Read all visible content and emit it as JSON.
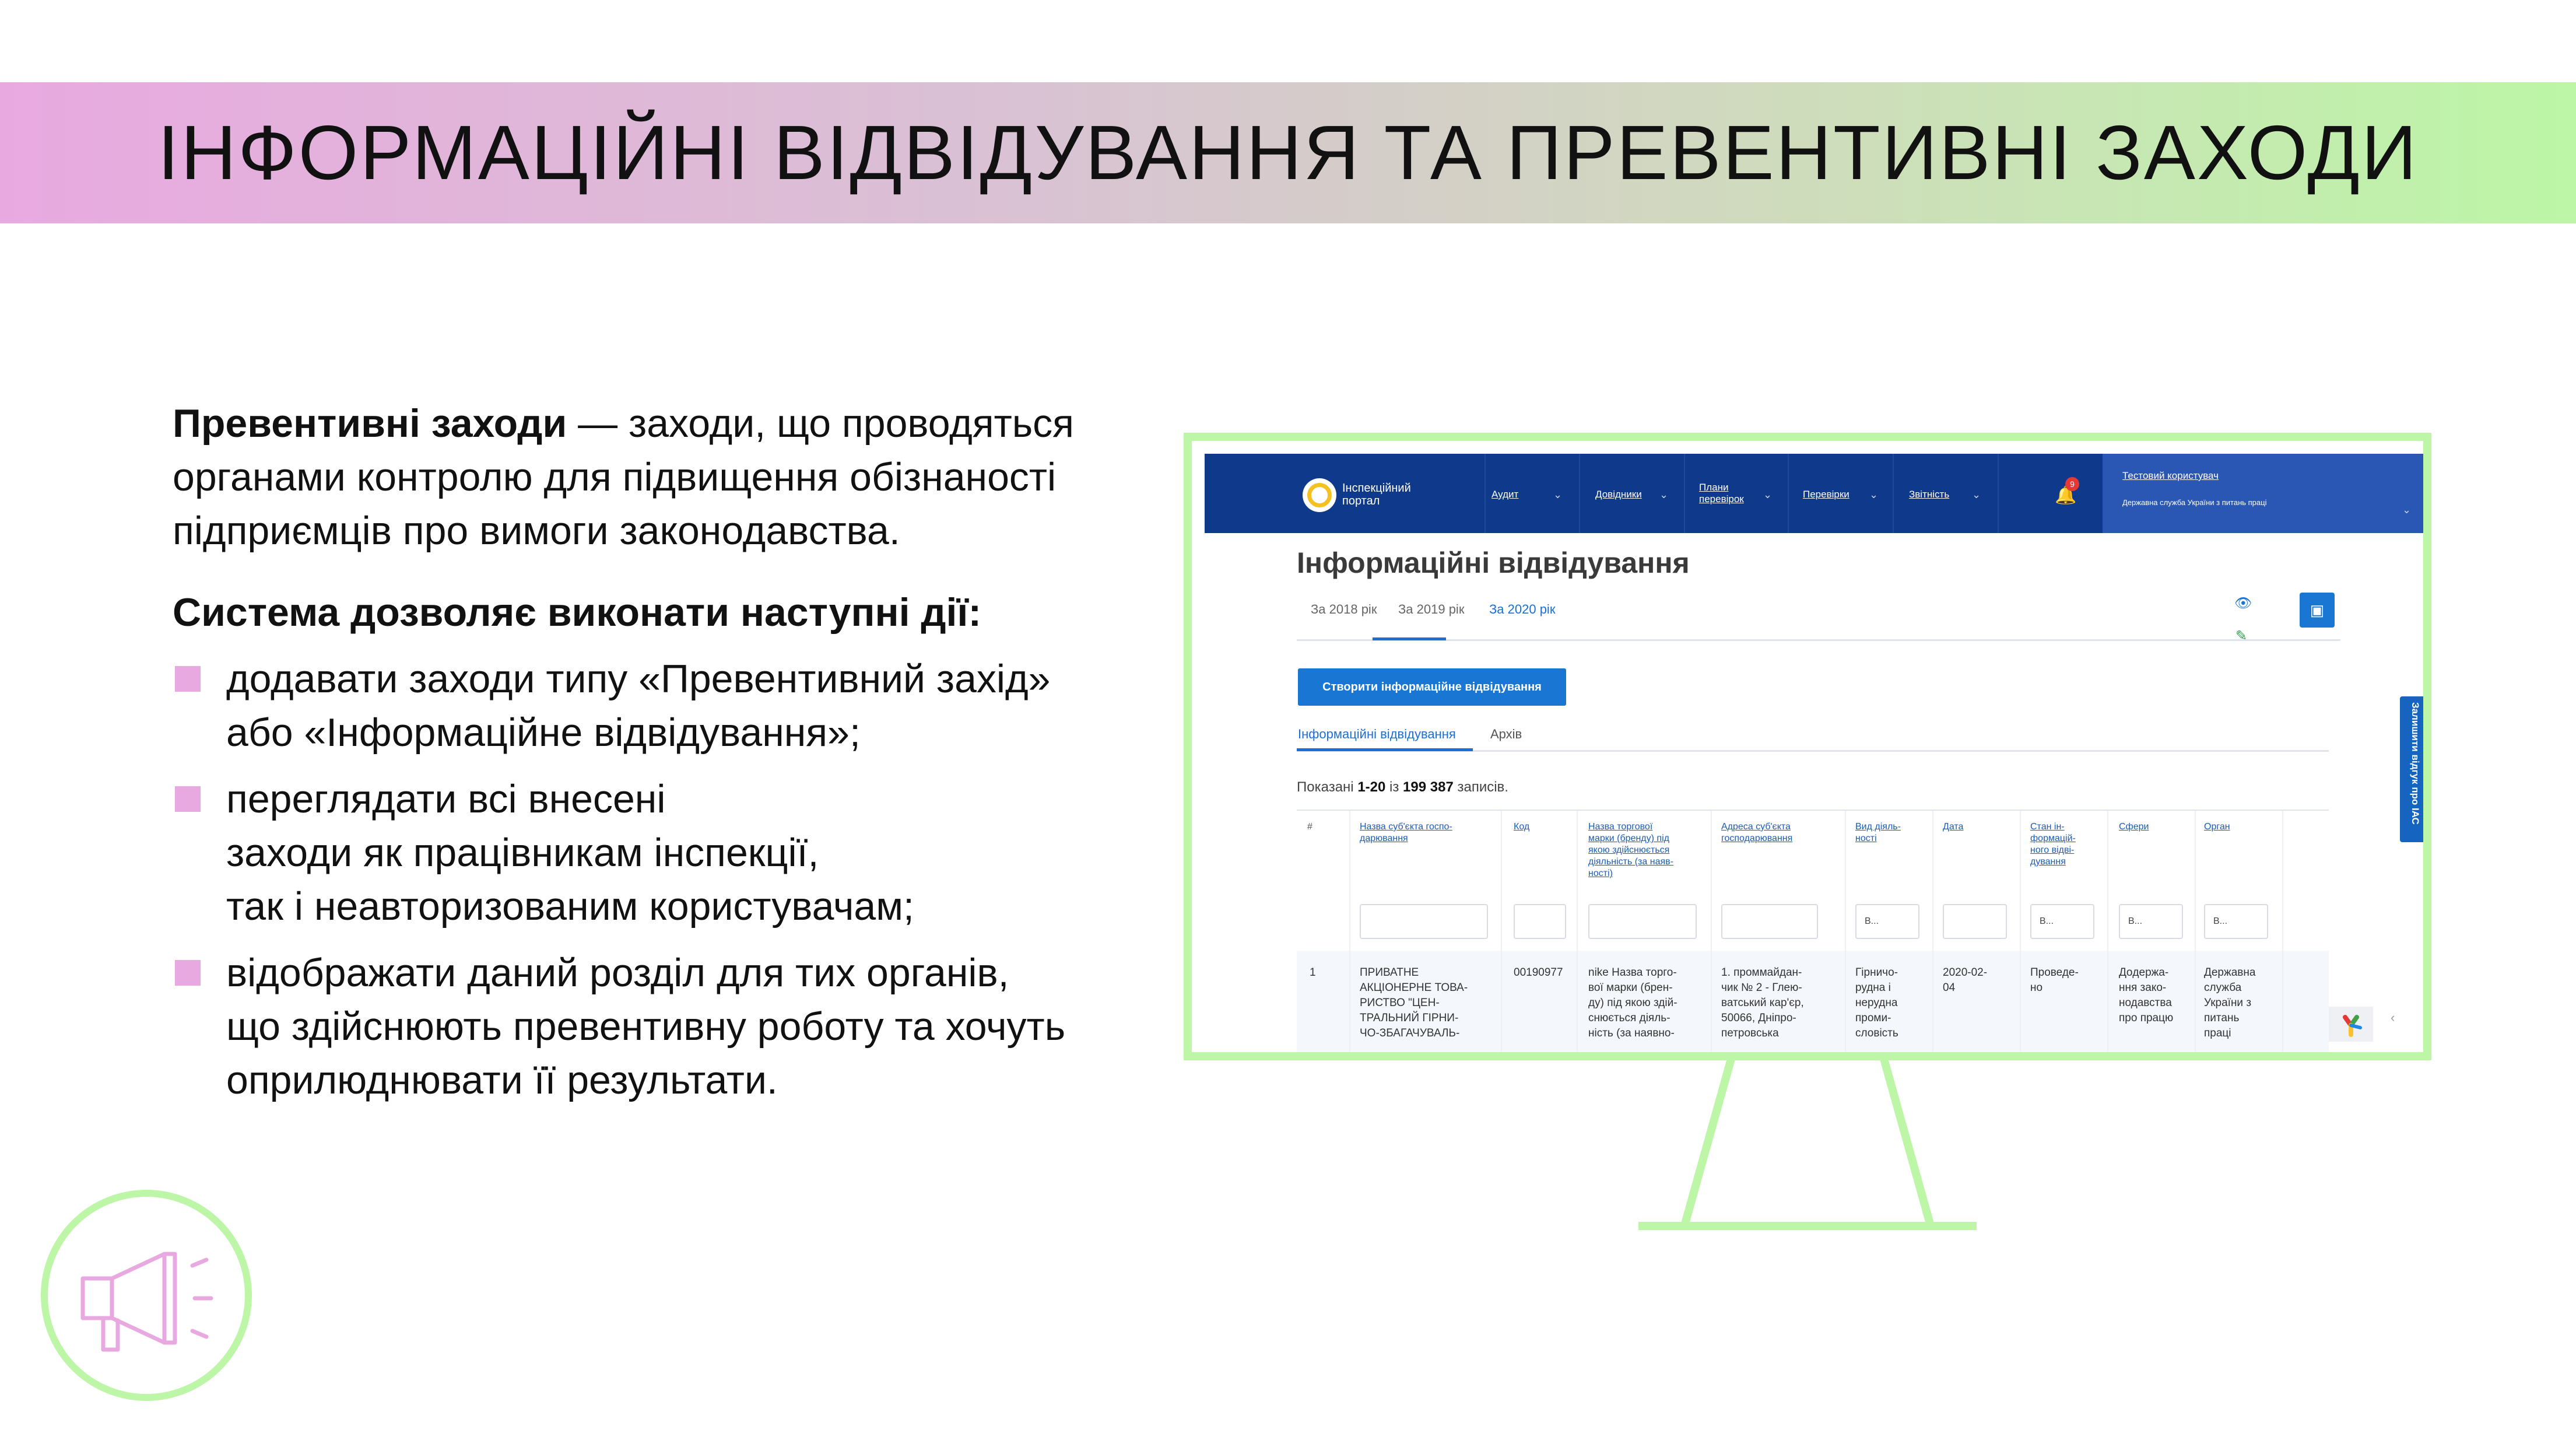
{
  "slide": {
    "title": "ІНФОРМАЦІЙНІ ВІДВІДУВАННЯ ТА ПРЕВЕНТИВНІ ЗАХОДИ",
    "definition_term": "Превентивні заходи",
    "definition_text": " — заходи, що проводяться органами контролю для підвищення обізнаності підприємців про вимоги законодавства.",
    "actions_title": "Система дозволяє виконати наступні дії:",
    "bullets": [
      "додавати заходи типу  «Превентивний захід»\nабо «Інформаційне відвідування»;",
      "переглядати всі внесені\nзаходи як працівникам інспекції,\nтак і неавторизованим користувачам;",
      "відображати даний розділ для тих органів,\nщо здійснюють превентивну роботу та хочуть\nоприлюднювати її результати."
    ],
    "colors": {
      "pink": "#e8a9e0",
      "green": "#bcf6a6"
    }
  },
  "portal": {
    "logo_text": "Інспекційний портал",
    "nav": [
      "Аудит",
      "Довідники",
      "Плани перевірок",
      "Перевірки",
      "Звітність"
    ],
    "bell_count": "9",
    "user_name": "Тестовий користувач",
    "user_org": "Державна служба України з питань праці",
    "page_title": "Інформаційні відвідування",
    "year_tabs": [
      "За 2018 рік",
      "За 2019 рік",
      "За 2020 рік"
    ],
    "create_button": "Створити інформаційне відвідування",
    "sub_tabs": [
      "Інформаційні відвідування",
      "Архів"
    ],
    "shown_prefix": "Показані ",
    "shown_range": "1-20",
    "shown_mid": " із ",
    "shown_total": "199 387",
    "shown_suffix": " записів.",
    "feedback_label": "Залишити відгук про ІАС",
    "columns": [
      "#",
      "Назва суб'єкта госпо-\nдарювання",
      "Код",
      "Назва торгової\nмарки (бренду) під\nякою здійснюється\nдіяльність (за наяв-\nності)",
      "Адреса суб'єкта\nгосподарювання",
      "Вид діяль-\nності",
      "Дата",
      "Стан ін-\nформацій-\nного відві-\nдування",
      "Сфери",
      "Орган"
    ],
    "filter_select": "В...",
    "row": [
      "1",
      "ПРИВАТНЕ\nАКЦІОНЕРНЕ ТОВА-\nРИСТВО \"ЦЕН-\nТРАЛЬНИЙ ГІРНИ-\nЧО-ЗБАГАЧУВАЛЬ-",
      "00190977",
      "nike Назва торго-\nвої марки (брен-\nду) під якою здій-\nснюється діяль-\nність (за наявно-",
      "1. проммайдан-\nчик № 2 - Глею-\nватський кар'єр,\n50066, Дніпро-\nпетровська",
      "Гірничо-\nрудна і\nнерудна\nпроми-\nсловість",
      "2020-02-\n04",
      "Проведе-\nно",
      "Дoдержа-\nння зако-\nнодавства\nпро працю",
      "Державна\nслужба\nУкраїни з\nпитань\nпраці"
    ]
  }
}
